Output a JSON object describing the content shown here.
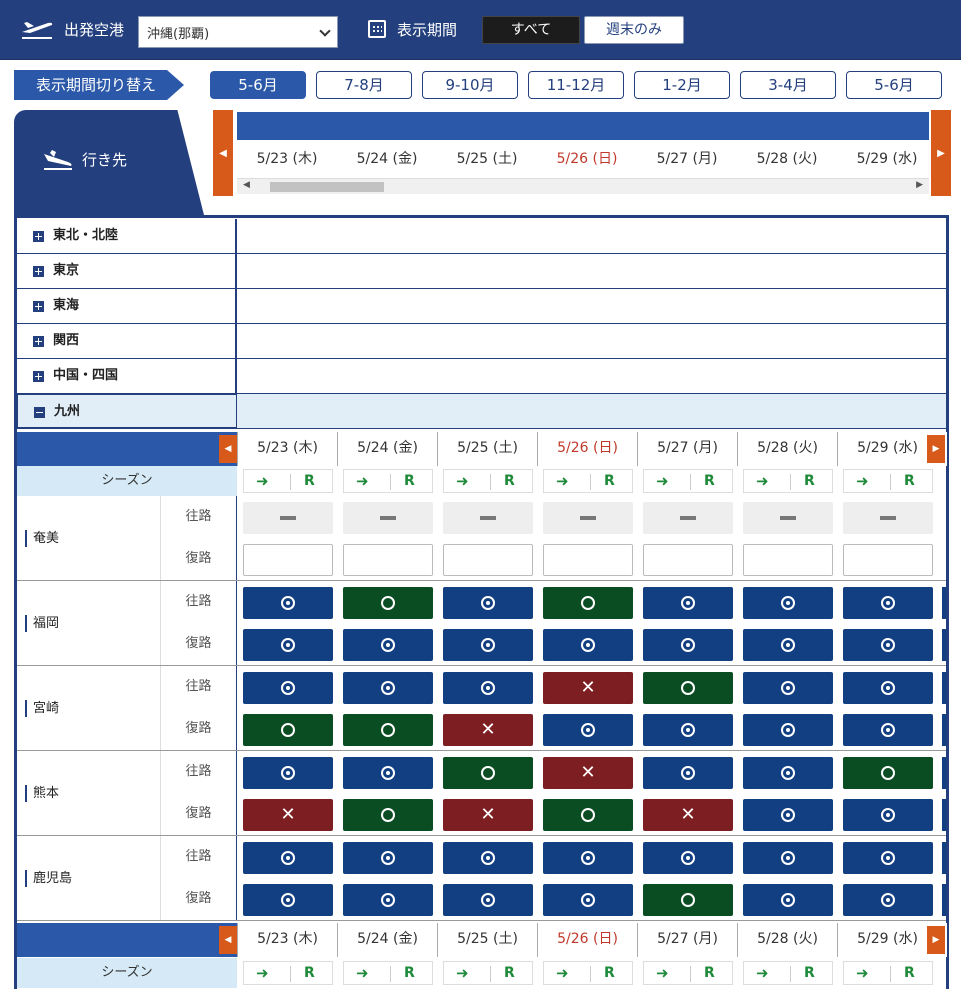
{
  "topbar": {
    "departure_label": "出発空港",
    "departure_value": "沖縄(那覇)",
    "period_label": "表示期間",
    "period_all": "すべて",
    "period_weekend": "週末のみ"
  },
  "switch_label": "表示期間切り替え",
  "month_tabs": [
    "5-6月",
    "7-8月",
    "9-10月",
    "11-12月",
    "1-2月",
    "3-4月",
    "5-6月"
  ],
  "active_month_index": 0,
  "dest_label": "行き先",
  "dates": [
    "5/23 (木)",
    "5/24 (金)",
    "5/25 (土)",
    "5/26 (日)",
    "5/27 (月)",
    "5/28 (火)",
    "5/29 (水)"
  ],
  "sunday_index": 3,
  "regions": [
    "東北・北陸",
    "東京",
    "東海",
    "関西",
    "中国・四国",
    "九州"
  ],
  "open_region": "九州",
  "season_label": "シーズン",
  "season_arrow": "➜",
  "season_r": "R",
  "dir_out": "往路",
  "dir_ret": "復路",
  "legend_note": "o2 = ◎ available, o1 = ○ few left, x = ✕ sold out, na = — no service, empty = blank",
  "cities": [
    {
      "name": "奄美",
      "out": [
        "na",
        "na",
        "na",
        "na",
        "na",
        "na",
        "na"
      ],
      "ret": [
        "empty",
        "empty",
        "empty",
        "empty",
        "empty",
        "empty",
        "empty"
      ]
    },
    {
      "name": "福岡",
      "out": [
        "o2",
        "o1",
        "o2",
        "o1",
        "o2",
        "o2",
        "o2"
      ],
      "ret": [
        "o2",
        "o2",
        "o2",
        "o2",
        "o2",
        "o2",
        "o2"
      ]
    },
    {
      "name": "宮崎",
      "out": [
        "o2",
        "o2",
        "o2",
        "x",
        "o1",
        "o2",
        "o2"
      ],
      "ret": [
        "o1",
        "o1",
        "x",
        "o2",
        "o2",
        "o2",
        "o2"
      ]
    },
    {
      "name": "熊本",
      "out": [
        "o2",
        "o2",
        "o1",
        "x",
        "o2",
        "o2",
        "o1"
      ],
      "ret": [
        "x",
        "o1",
        "x",
        "o1",
        "x",
        "o2",
        "o2"
      ]
    },
    {
      "name": "鹿児島",
      "out": [
        "o2",
        "o2",
        "o2",
        "o2",
        "o2",
        "o2",
        "o2"
      ],
      "ret": [
        "o2",
        "o2",
        "o2",
        "o2",
        "o1",
        "o2",
        "o2"
      ]
    }
  ],
  "colors": {
    "navy": "#233f7e",
    "accent_blue": "#2b58a8",
    "available": "#123e82",
    "few_left": "#0b4d22",
    "sold_out": "#7d1e22",
    "nav_orange": "#d85a1a",
    "sunday_red": "#c0392b"
  }
}
